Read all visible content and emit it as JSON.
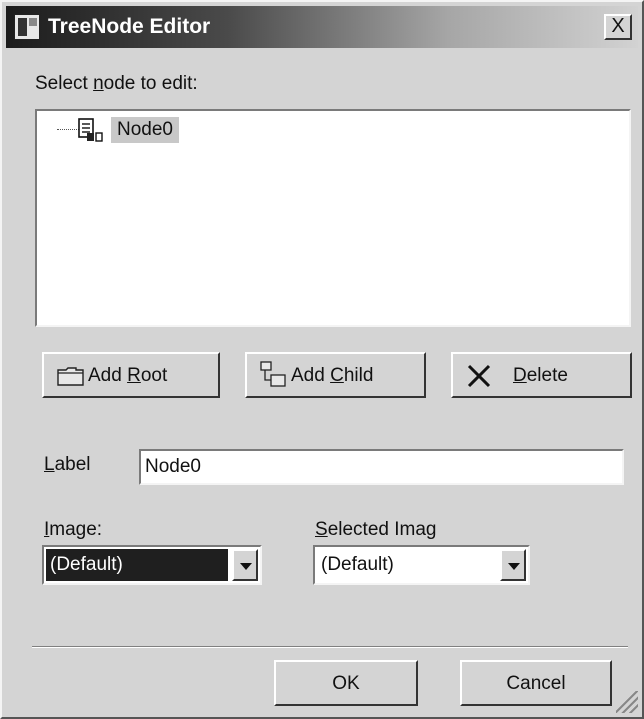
{
  "window": {
    "title": "TreeNode Editor",
    "close_label": "X"
  },
  "tree": {
    "prompt_prefix": "Select ",
    "prompt_accel": "n",
    "prompt_suffix": "ode to edit:",
    "nodes": [
      {
        "label": "Node0",
        "selected": true,
        "icon": "document-icon"
      }
    ]
  },
  "buttons": {
    "add_root": {
      "pre": "Add ",
      "accel": "R",
      "post": "oot",
      "icon": "folder-icon"
    },
    "add_child": {
      "pre": "Add ",
      "accel": "C",
      "post": "hild",
      "icon": "add-child-icon"
    },
    "delete": {
      "pre": "",
      "accel": "D",
      "post": "elete",
      "icon": "delete-x-icon"
    },
    "ok": "OK",
    "cancel": "Cancel"
  },
  "label_field": {
    "label_accel": "L",
    "label_rest": "abel",
    "value": "Node0"
  },
  "image_field": {
    "label_accel": "I",
    "label_rest": "mage:",
    "value": "(Default)"
  },
  "selected_image_field": {
    "label_accel": "S",
    "label_rest": "elected Imag",
    "value": "(Default)"
  }
}
